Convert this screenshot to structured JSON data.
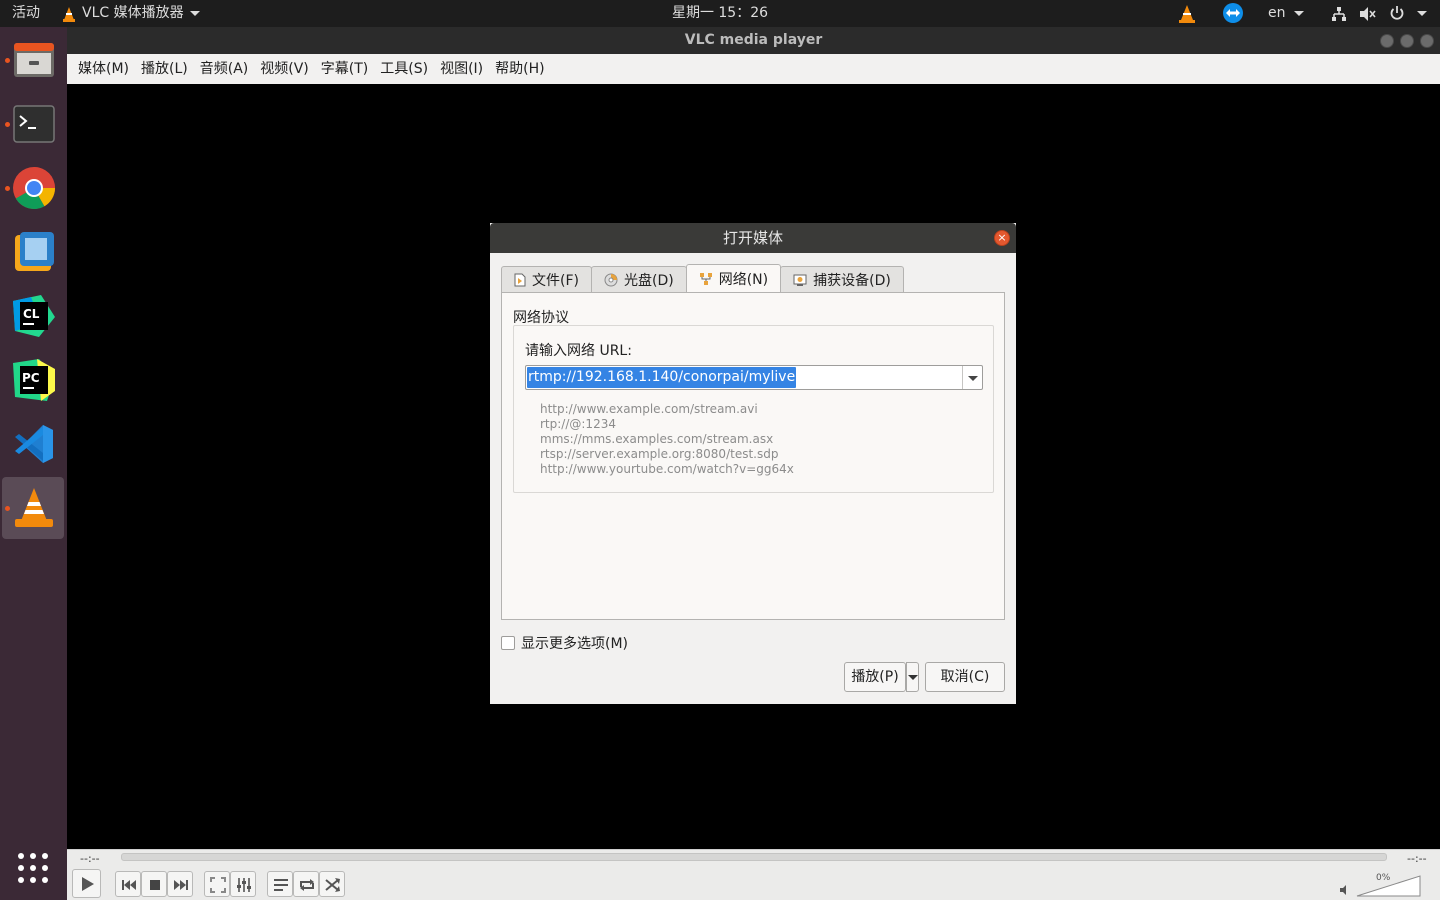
{
  "topbar": {
    "activities": "活动",
    "app_name": "VLC 媒体播放器",
    "clock": "星期一 15：26",
    "lang": "en"
  },
  "window": {
    "title": "VLC media player"
  },
  "menubar": {
    "items": [
      "媒体(M)",
      "播放(L)",
      "音频(A)",
      "视频(V)",
      "字幕(T)",
      "工具(S)",
      "视图(I)",
      "帮助(H)"
    ]
  },
  "controls": {
    "elapsed": "--:--",
    "remaining": "--:--",
    "volume": "0%"
  },
  "dialog": {
    "title": "打开媒体",
    "tabs": [
      "文件(F)",
      "光盘(D)",
      "网络(N)",
      "捕获设备(D)"
    ],
    "selected_tab": "网络(N)",
    "protocol_label": "网络协议",
    "url_label": "请输入网络 URL:",
    "url_value": "rtmp://192.168.1.140/conorpai/mylive",
    "examples": [
      "http://www.example.com/stream.avi",
      "rtp://@:1234",
      "mms://mms.examples.com/stream.asx",
      "rtsp://server.example.org:8080/test.sdp",
      "http://www.yourtube.com/watch?v=gg64x"
    ],
    "more_options": "显示更多选项(M)",
    "more_options_checked": false,
    "play_label": "播放(P)",
    "cancel_label": "取消(C)"
  },
  "dock": {
    "apps": [
      "files-icon",
      "terminal-icon",
      "chrome-icon",
      "virtualbox-icon",
      "clion-icon",
      "pycharm-icon",
      "vscode-icon",
      "vlc-icon"
    ],
    "active_app": "vlc-icon"
  },
  "colors": {
    "accent": "#e95420",
    "selection": "#3584e4",
    "dock_bg": "#3b2936"
  }
}
